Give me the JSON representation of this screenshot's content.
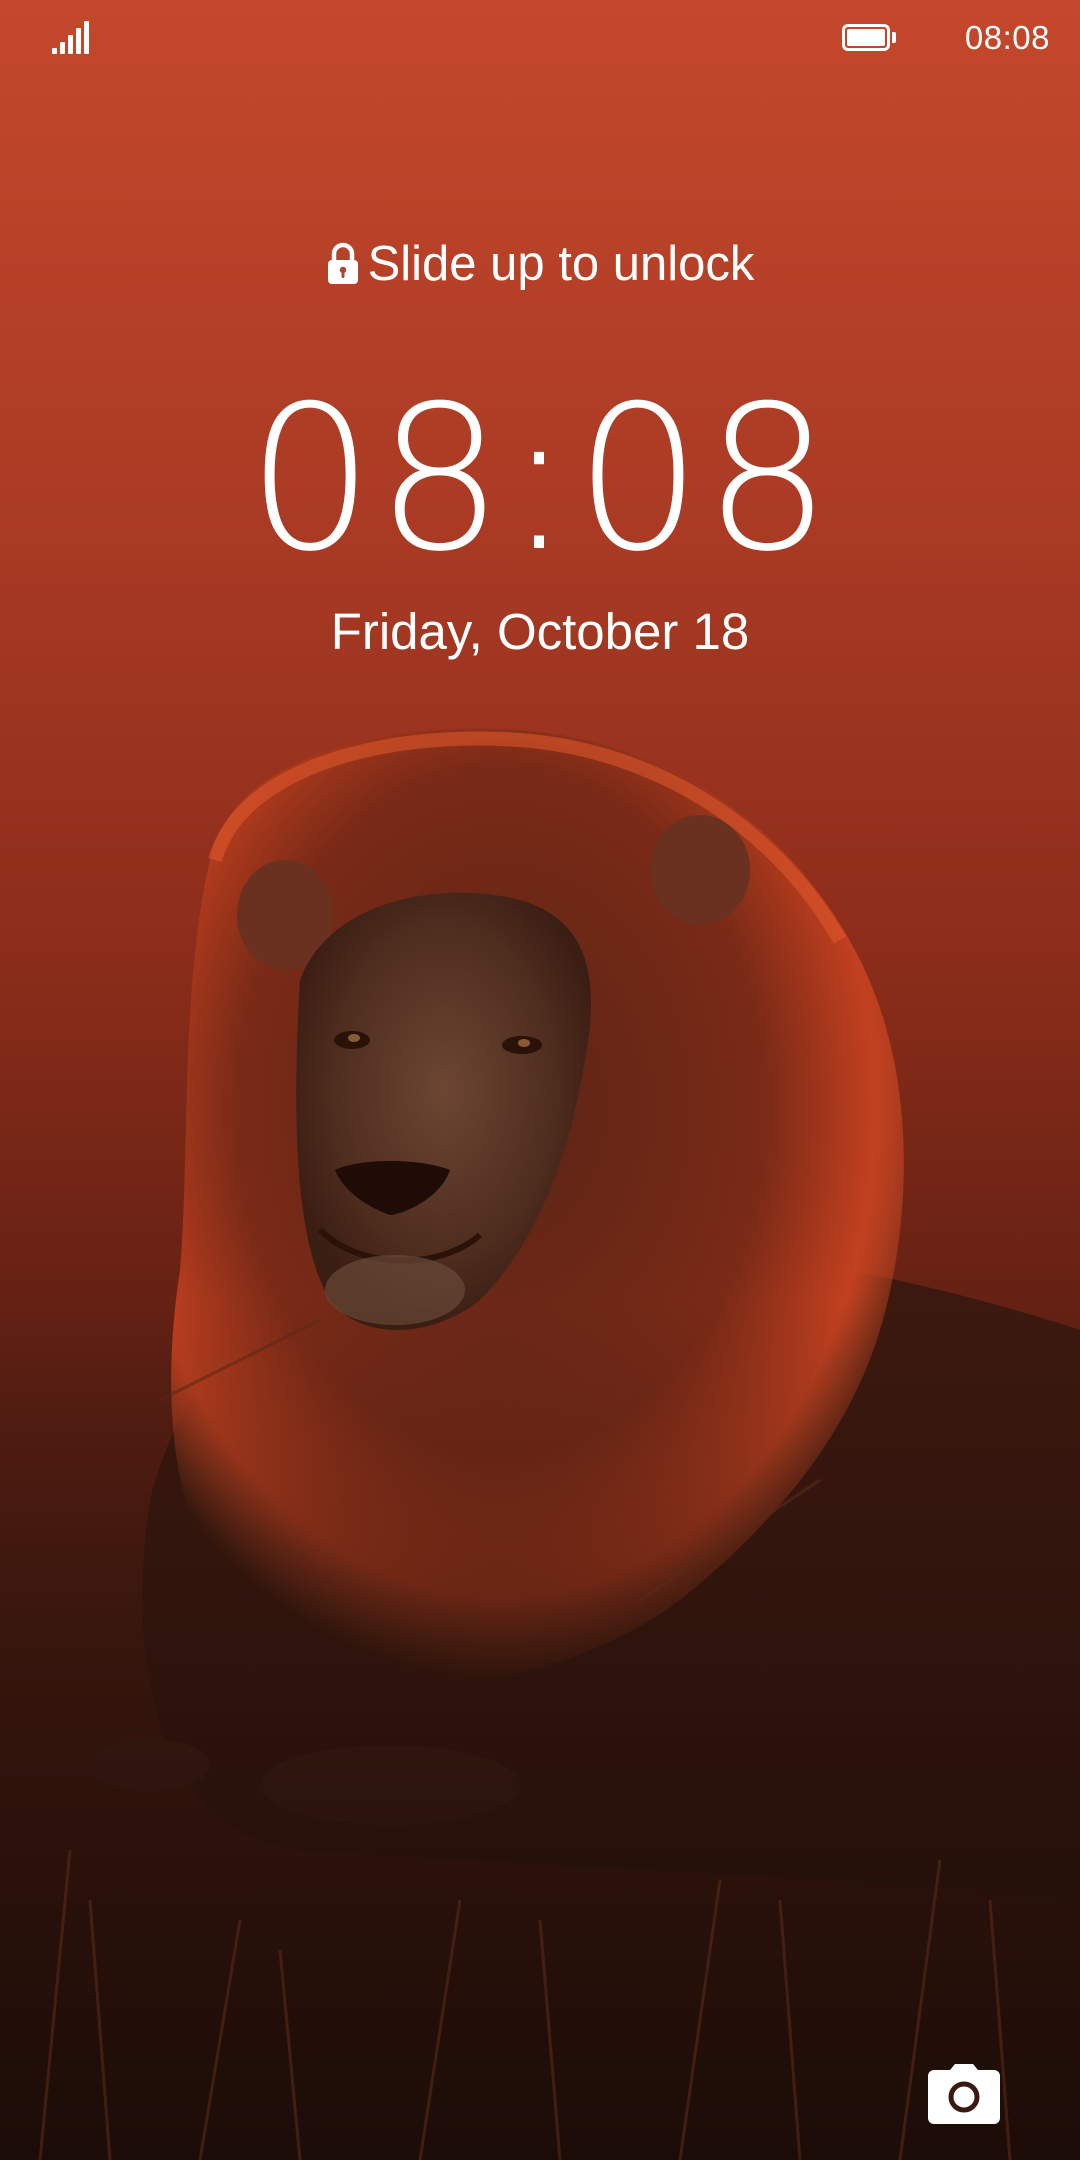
{
  "status_bar": {
    "signal_icon": "signal-bars-icon",
    "battery_icon": "battery-full-icon",
    "time": "08:08"
  },
  "lock_screen": {
    "unlock_hint": "Slide up to unlock",
    "lock_icon": "lock-icon",
    "clock": "08:08",
    "date": "Friday, October 18",
    "camera_icon": "camera-icon"
  },
  "wallpaper": {
    "subject": "lion-wallpaper",
    "colors": {
      "sky_top": "#c74a2c",
      "sky_mid": "#9e3220",
      "ground": "#3a160f",
      "mane": "#b63a1f"
    }
  }
}
